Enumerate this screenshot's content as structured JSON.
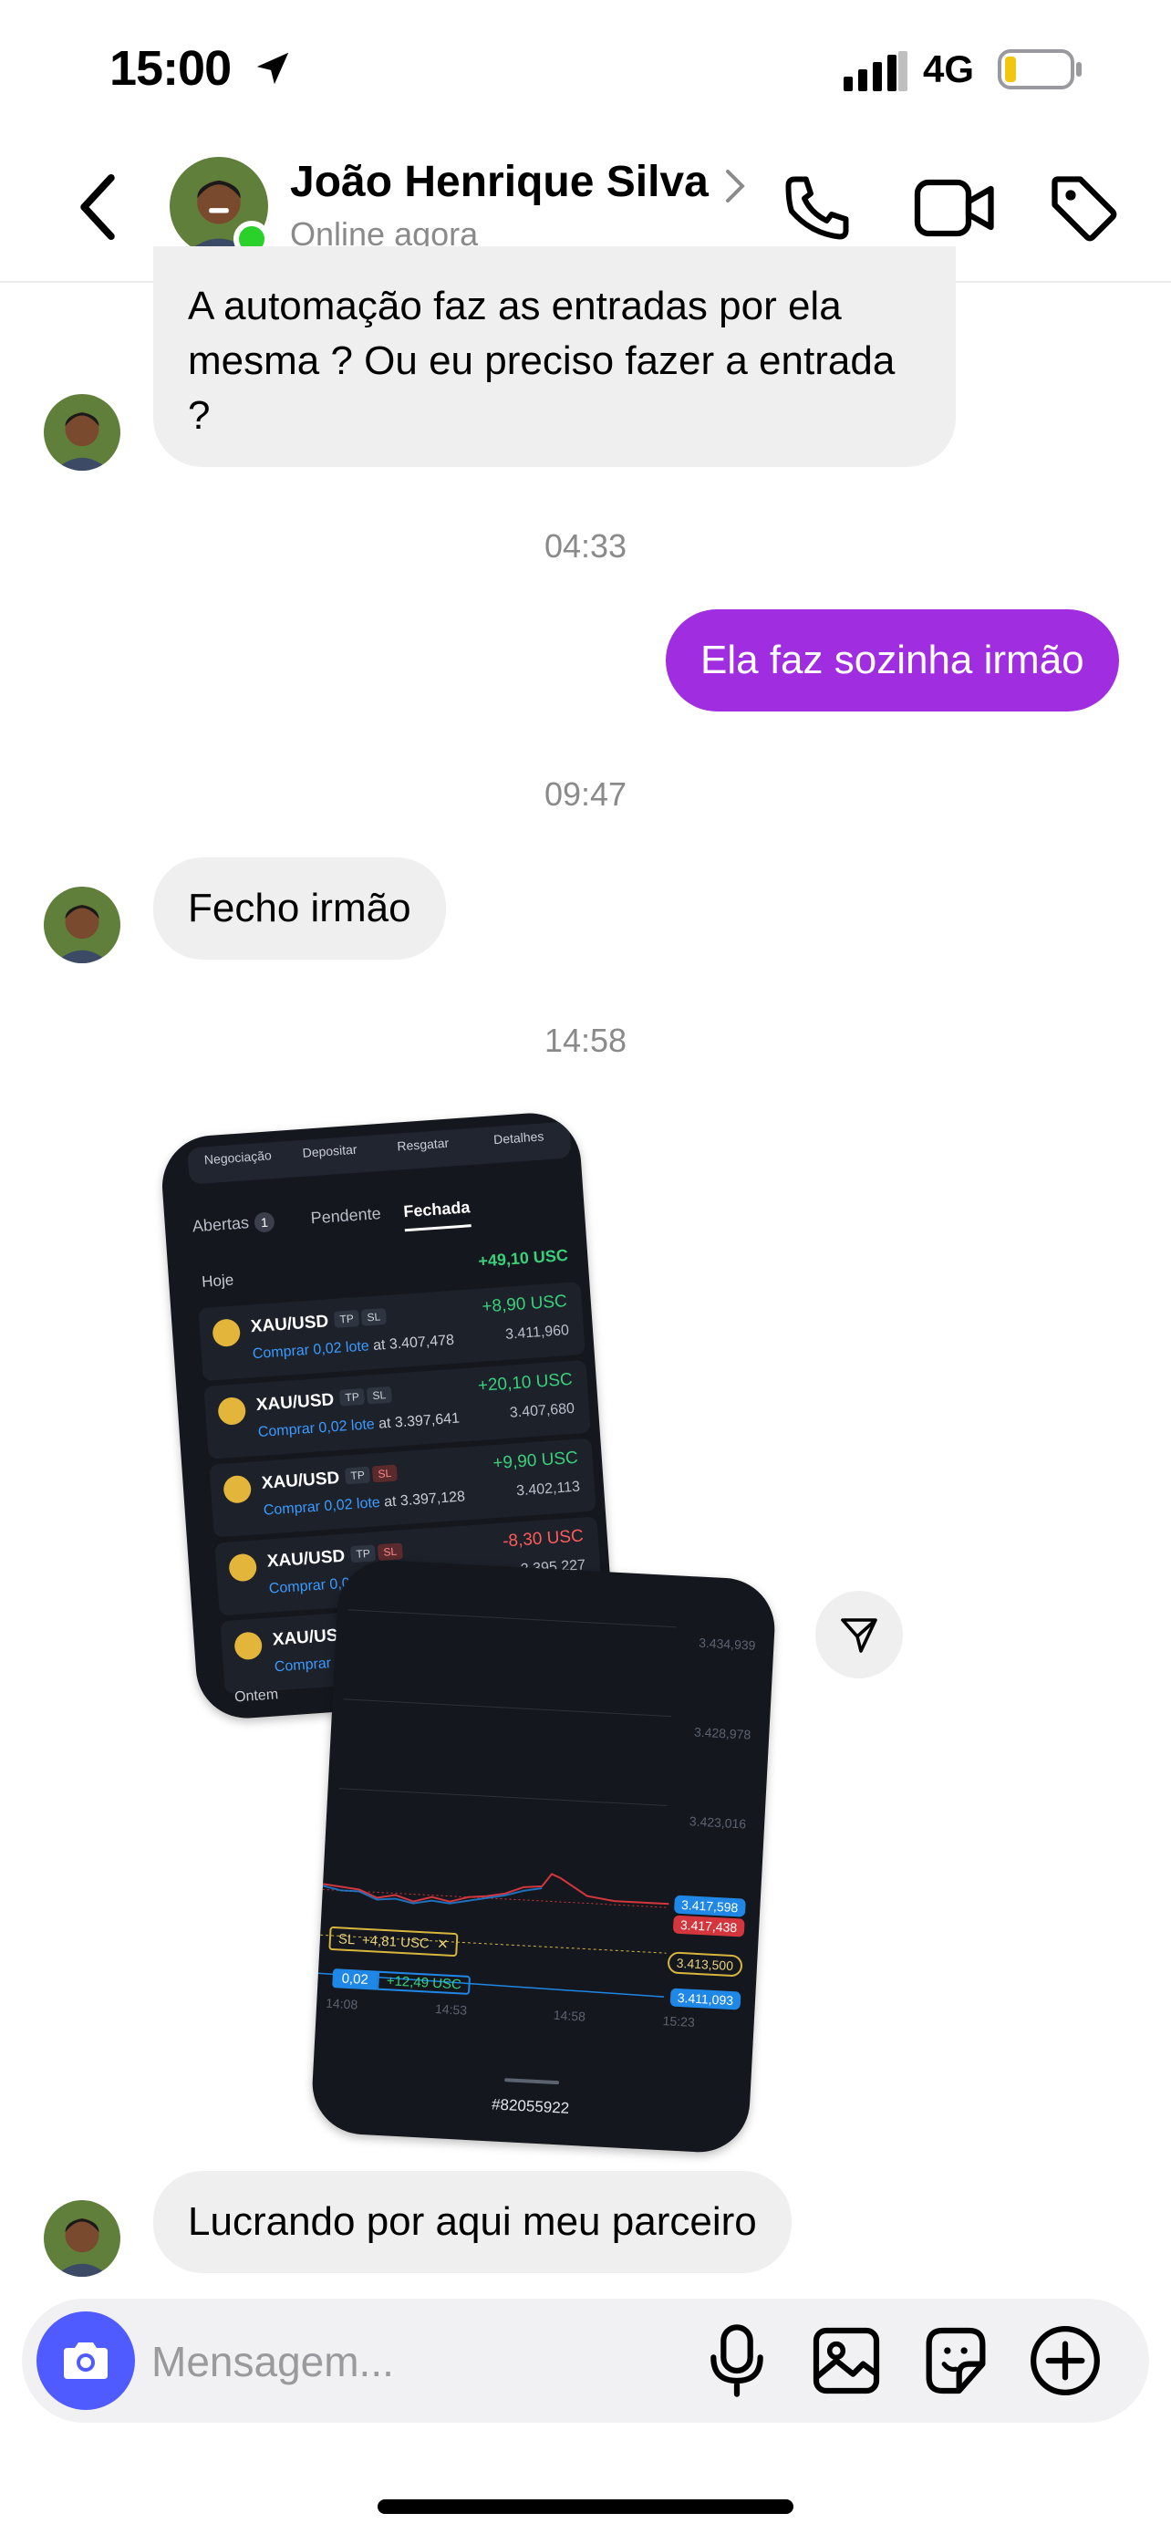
{
  "status_bar": {
    "time": "15:00",
    "network": "4G"
  },
  "header": {
    "contact_name": "João Henrique Silva",
    "contact_status": "Online agora"
  },
  "messages": [
    {
      "direction": "in",
      "text": "A automação faz as entradas por ela mesma ? Ou eu preciso fazer a entrada ?"
    },
    {
      "timestamp": "04:33"
    },
    {
      "direction": "out",
      "text": "Ela faz sozinha irmão"
    },
    {
      "timestamp": "09:47"
    },
    {
      "direction": "in",
      "text": "Fecho irmão"
    },
    {
      "timestamp": "14:58"
    },
    {
      "direction": "in",
      "text": "Lucrando por aqui meu parceiro"
    }
  ],
  "screenshot1": {
    "top_tabs": [
      "Negociação",
      "Depositar",
      "Resgatar",
      "Detalhes"
    ],
    "segments": [
      "Abertas",
      "Pendente",
      "Fechada"
    ],
    "open_count": "1",
    "day_label": "Hoje",
    "day_total": "+49,10 USC",
    "chip_tp": "TP",
    "chip_sl": "SL",
    "order_side": "Comprar 0,02 lote",
    "rows": [
      {
        "pair": "XAU/USD",
        "entry": "at 3.407,478",
        "pnl": "+8,90 USC",
        "close": "3.411,960"
      },
      {
        "pair": "XAU/USD",
        "entry": "at 3.397,641",
        "pnl": "+20,10 USC",
        "close": "3.407,680"
      },
      {
        "pair": "XAU/USD",
        "entry": "at 3.397,128",
        "pnl": "+9,90 USC",
        "close": "3.402,113"
      },
      {
        "pair": "XAU/USD",
        "entry": "",
        "pnl": "-8,30 USC",
        "close": "3.395,227"
      },
      {
        "pair": "XAU/USD",
        "entry": "",
        "pnl": "",
        "close": ""
      }
    ],
    "footer_label": "Ontem"
  },
  "screenshot2": {
    "price_levels": [
      "3.434,939",
      "3.428,978",
      "3.423,016"
    ],
    "bid_tag": "3.417,598",
    "ask_tag": "3.417,438",
    "sl_tag": "3.413,500",
    "entry_tag": "3.411,093",
    "sl_label": "SL",
    "sl_value": "+4,81 USC",
    "lot_qty": "0,02",
    "lot_profit": "+12,49 USC",
    "time_labels": [
      "14:08",
      "14:53",
      "14:58",
      "15:23"
    ],
    "order_id": "#82055922"
  },
  "composer": {
    "placeholder": "Mensagem..."
  },
  "colors": {
    "outgoing_bubble": "#a12de0",
    "camera_button": "#4f5bff",
    "online_dot": "#2bd12b"
  }
}
